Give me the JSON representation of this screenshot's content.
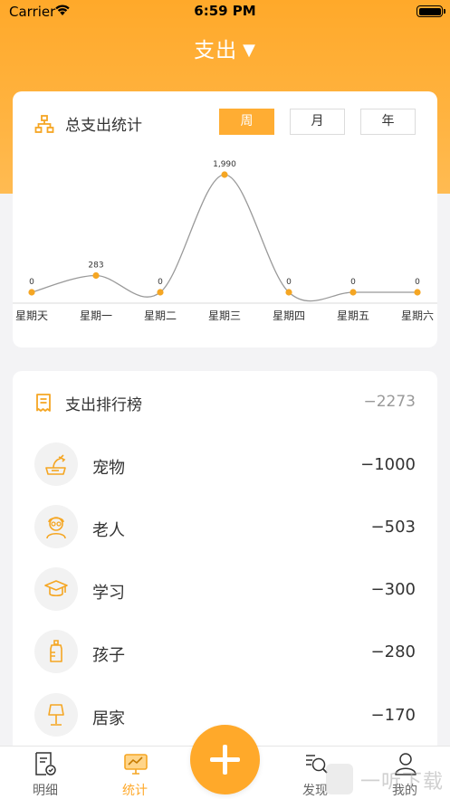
{
  "status_bar": {
    "carrier": "Carrier",
    "time": "6:59 PM"
  },
  "nav": {
    "title": "支出",
    "dropdown_glyph": "▼"
  },
  "summary": {
    "title": "总支出统计",
    "icon": "org-chart-icon",
    "periods": [
      "周",
      "月",
      "年"
    ],
    "active_period": "周"
  },
  "chart_data": {
    "type": "line",
    "categories": [
      "星期天",
      "星期一",
      "星期二",
      "星期三",
      "星期四",
      "星期五",
      "星期六"
    ],
    "tick_labels": [
      "星期天",
      "星期一",
      "星期二",
      "星期三",
      "星期四",
      "星期五",
      "星期六"
    ],
    "values": [
      0,
      283,
      0,
      1990,
      0,
      0,
      0
    ],
    "data_labels": [
      "0",
      "283",
      "0",
      "1,990",
      "0",
      "0",
      "0"
    ],
    "line_color": "#999999",
    "point_color": "#f5a623",
    "ylim": [
      0,
      1990
    ],
    "grid": false,
    "smooth": true
  },
  "ranking": {
    "title": "支出排行榜",
    "icon": "receipt-icon",
    "total": "−2273",
    "items": [
      {
        "name": "宠物",
        "amount": "−1000",
        "icon": "pet-icon"
      },
      {
        "name": "老人",
        "amount": "−503",
        "icon": "elder-icon"
      },
      {
        "name": "学习",
        "amount": "−300",
        "icon": "graduation-cap-icon"
      },
      {
        "name": "孩子",
        "amount": "−280",
        "icon": "baby-bottle-icon"
      },
      {
        "name": "居家",
        "amount": "−170",
        "icon": "lamp-icon"
      }
    ]
  },
  "tabbar": {
    "items": [
      {
        "label": "明细",
        "icon": "bill-icon"
      },
      {
        "label": "统计",
        "icon": "chart-monitor-icon",
        "active": true
      },
      {
        "label": "发现",
        "icon": "search-doc-icon"
      },
      {
        "label": "我的",
        "icon": "user-icon"
      }
    ],
    "add_icon": "plus-icon"
  },
  "watermark": "一听下载",
  "colors": {
    "accent": "#ffa92a",
    "background": "#f3f3f5"
  }
}
